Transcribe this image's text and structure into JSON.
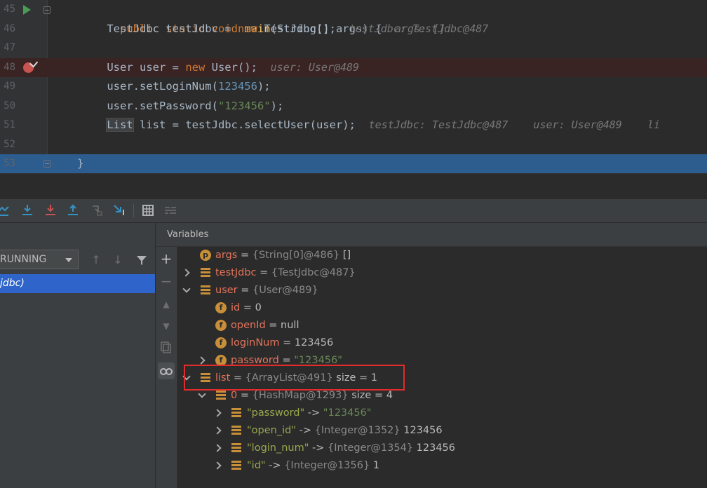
{
  "editor": {
    "lines": [
      {
        "num": "45",
        "parts": [
          [
            "kw",
            "public static void "
          ],
          [
            "fn",
            "main"
          ],
          [
            "p",
            "(String[] args) {"
          ]
        ],
        "hint": "args: []"
      },
      {
        "num": "46",
        "parts": [
          [
            "p",
            "    TestJdbc testJdbc = "
          ],
          [
            "kw",
            "new "
          ],
          [
            "p",
            "TestJdbc();"
          ]
        ],
        "hint": "testJdbc: TestJdbc@487"
      },
      {
        "num": "47",
        "parts": [],
        "hint": ""
      },
      {
        "num": "48",
        "parts": [
          [
            "p",
            "    User user = "
          ],
          [
            "kw",
            "new "
          ],
          [
            "p",
            "User();"
          ]
        ],
        "hint": "user: User@489"
      },
      {
        "num": "49",
        "parts": [
          [
            "p",
            "    user.setLoginNum("
          ],
          [
            "num",
            "123456"
          ],
          [
            "p",
            ");"
          ]
        ],
        "hint": ""
      },
      {
        "num": "50",
        "parts": [
          [
            "p",
            "    user.setPassword("
          ],
          [
            "str",
            "\"123456\""
          ],
          [
            "p",
            ");"
          ]
        ],
        "hint": ""
      },
      {
        "num": "51",
        "parts": [
          [
            "p",
            "    "
          ],
          [
            "hl",
            "List"
          ],
          [
            "p",
            " list = testJdbc.selectUser(user);"
          ]
        ],
        "hint": "testJdbc: TestJdbc@487    user: User@489    li"
      },
      {
        "num": "52",
        "parts": [],
        "hint": ""
      },
      {
        "num": "53",
        "parts": [
          [
            "p",
            "}"
          ]
        ],
        "hint": ""
      }
    ]
  },
  "frames": {
    "thread_state": "RUNNING",
    "selected_frame": "jdbc)"
  },
  "variables": {
    "title": "Variables",
    "rows": [
      {
        "name": "args",
        "eq": " = ",
        "type": "{String[0]@486}",
        "value": " []",
        "icon": "p"
      },
      {
        "name": "testJdbc",
        "eq": " = ",
        "type": "{TestJdbc@487}",
        "value": "",
        "icon": "list"
      },
      {
        "name": "user",
        "eq": " = ",
        "type": "{User@489}",
        "value": "",
        "icon": "list"
      },
      {
        "name": "id",
        "eq": " = ",
        "type": "",
        "value": "0",
        "icon": "f"
      },
      {
        "name": "openId",
        "eq": " = ",
        "type": "",
        "value": "null",
        "icon": "f"
      },
      {
        "name": "loginNum",
        "eq": " = ",
        "type": "",
        "value": "123456",
        "icon": "f"
      },
      {
        "name": "password",
        "eq": " = ",
        "type": "",
        "value": "\"123456\"",
        "icon": "f"
      },
      {
        "name": "list",
        "eq": " = ",
        "type": "{ArrayList@491}",
        "value": "  size = 1",
        "icon": "list"
      },
      {
        "name": "0",
        "eq": " = ",
        "type": "{HashMap@1293}",
        "value": "  size = 4",
        "icon": "list"
      },
      {
        "name": "\"password\"",
        "eq": " -> ",
        "type": "",
        "value": "\"123456\"",
        "icon": "list"
      },
      {
        "name": "\"open_id\"",
        "eq": " -> ",
        "type": "{Integer@1352}",
        "value": " 123456",
        "icon": "list"
      },
      {
        "name": "\"login_num\"",
        "eq": " -> ",
        "type": "{Integer@1354}",
        "value": " 123456",
        "icon": "list"
      },
      {
        "name": "\"id\"",
        "eq": " -> ",
        "type": "{Integer@1356}",
        "value": " 1",
        "icon": "list"
      }
    ]
  },
  "colors": {
    "keyword": "#cc7832",
    "method": "#ffc66d",
    "number": "#6897bb",
    "string": "#6a8759",
    "selection": "#2d5c8f",
    "frame_selected": "#2f65ca",
    "highlight_box": "#e02c2c"
  }
}
